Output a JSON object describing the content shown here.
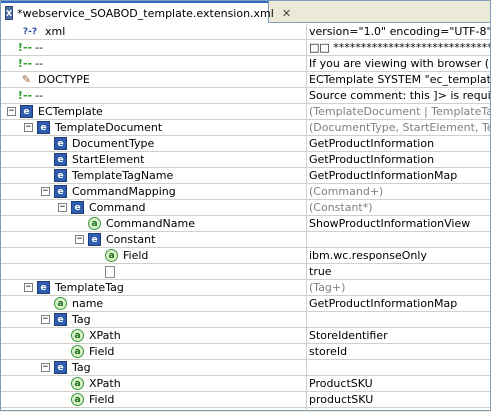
{
  "editor": {
    "tab_title": "*webservice_SOABOD_template.extension.xml",
    "tab_icon": "X",
    "close_glyph": "✕"
  },
  "rows": [
    {
      "name": "xml",
      "icon": "pi",
      "toggle": "none",
      "value": "version=\"1.0\" encoding=\"UTF-8\"",
      "value_gray": false
    },
    {
      "name": "--",
      "icon": "comment",
      "toggle": "none",
      "value": "□□ *******************************",
      "value_gray": false
    },
    {
      "name": "--",
      "icon": "comment",
      "toggle": "none",
      "value": "If you are viewing with browser (IE fo",
      "value_gray": false
    },
    {
      "name": "DOCTYPE",
      "icon": "doctype",
      "toggle": "none",
      "value": "ECTemplate SYSTEM \"ec_template.dtd",
      "value_gray": false
    },
    {
      "name": "--",
      "icon": "comment",
      "toggle": "none",
      "value": "Source comment: this ]> is required, c",
      "value_gray": false
    },
    {
      "name": "ECTemplate",
      "icon": "e",
      "toggle": "minus",
      "value": "(TemplateDocument | TemplateTag)*",
      "value_gray": true
    },
    {
      "name": "TemplateDocument",
      "icon": "e",
      "toggle": "minus",
      "value": "(DocumentType, StartElement, Templa",
      "value_gray": true
    },
    {
      "name": "DocumentType",
      "icon": "e",
      "toggle": "none",
      "value": "GetProductInformation",
      "value_gray": false
    },
    {
      "name": "StartElement",
      "icon": "e",
      "toggle": "none",
      "value": "GetProductInformation",
      "value_gray": false
    },
    {
      "name": "TemplateTagName",
      "icon": "e",
      "toggle": "none",
      "value": "GetProductInformationMap",
      "value_gray": false
    },
    {
      "name": "CommandMapping",
      "icon": "e",
      "toggle": "minus",
      "value": "(Command+)",
      "value_gray": true
    },
    {
      "name": "Command",
      "icon": "e",
      "toggle": "minus",
      "value": "(Constant*)",
      "value_gray": true
    },
    {
      "name": "CommandName",
      "icon": "a",
      "toggle": "none",
      "value": "ShowProductInformationView",
      "value_gray": false
    },
    {
      "name": "Constant",
      "icon": "e",
      "toggle": "minus",
      "value": "",
      "value_gray": false
    },
    {
      "name": "Field",
      "icon": "a",
      "toggle": "none",
      "value": "ibm.wc.responseOnly",
      "value_gray": false
    },
    {
      "name": "",
      "icon": "text",
      "toggle": "none",
      "value": "true",
      "value_gray": false
    },
    {
      "name": "TemplateTag",
      "icon": "e",
      "toggle": "minus",
      "value": "(Tag+)",
      "value_gray": true
    },
    {
      "name": "name",
      "icon": "a",
      "toggle": "none",
      "value": "GetProductInformationMap",
      "value_gray": false
    },
    {
      "name": "Tag",
      "icon": "e",
      "toggle": "minus",
      "value": "",
      "value_gray": false
    },
    {
      "name": "XPath",
      "icon": "a",
      "toggle": "none",
      "value": "StoreIdentifier",
      "value_gray": false
    },
    {
      "name": "Field",
      "icon": "a",
      "toggle": "none",
      "value": "storeId",
      "value_gray": false
    },
    {
      "name": "Tag",
      "icon": "e",
      "toggle": "minus",
      "value": "",
      "value_gray": false
    },
    {
      "name": "XPath",
      "icon": "a",
      "toggle": "none",
      "value": "ProductSKU",
      "value_gray": false
    },
    {
      "name": "Field",
      "icon": "a",
      "toggle": "none",
      "value": "productSKU",
      "value_gray": false
    }
  ],
  "icons": {
    "pi": "?-?",
    "comment": "!--",
    "doctype": "✎",
    "e": "e",
    "a": "a"
  },
  "colors": {
    "accent": "#316ac5",
    "element_icon": "#2f5db0",
    "attribute_icon": "#3a9a3a",
    "gray_text": "#808080",
    "row_line": "#d4d0c8"
  }
}
